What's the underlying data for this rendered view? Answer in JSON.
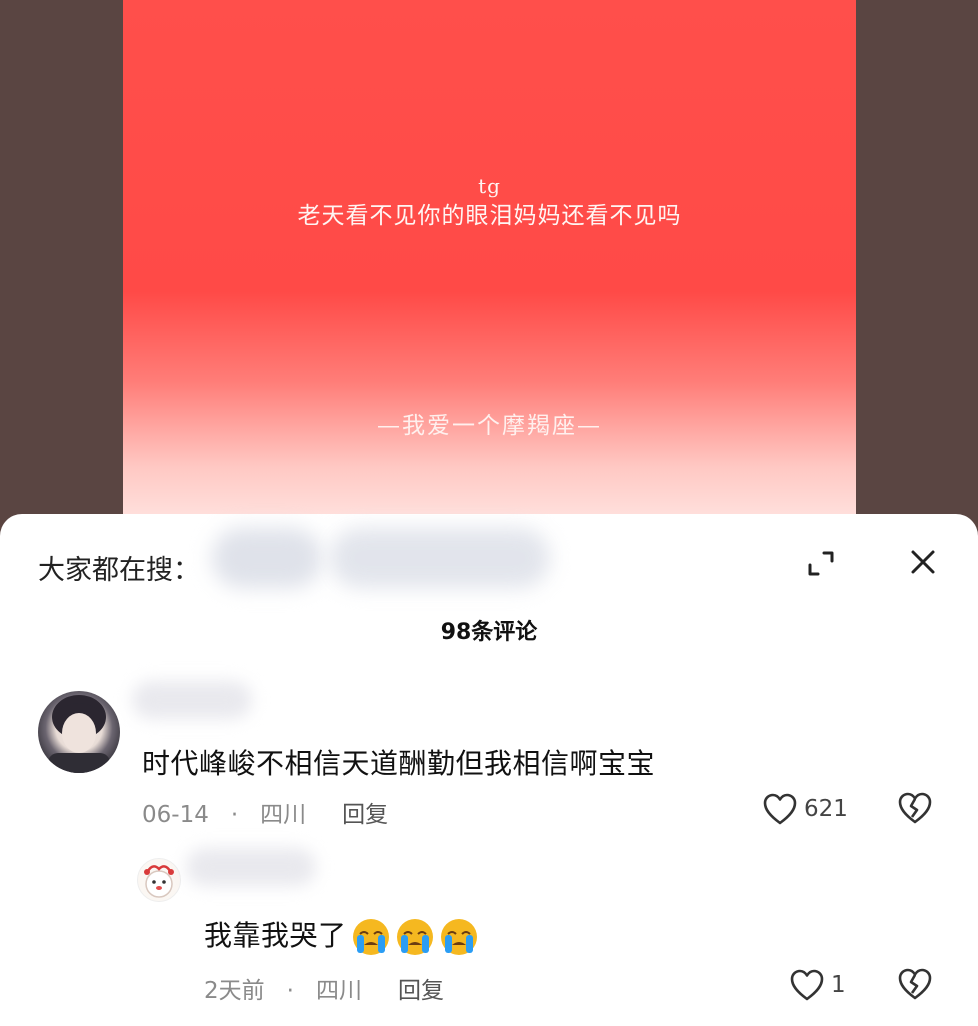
{
  "video": {
    "tag": "tg",
    "line1": "老天看不见你的眼泪妈妈还看不见吗",
    "line2": "—我爱一个摩羯座—"
  },
  "sheet": {
    "search_label": "大家都在搜：",
    "comment_count": "98条评论"
  },
  "comments": [
    {
      "text": "时代峰峻不相信天道酬勤但我相信啊宝宝",
      "date": "06-14",
      "location": "四川",
      "reply_label": "回复",
      "likes": "621"
    },
    {
      "text": "我靠我哭了",
      "emoji": "crying-emoji",
      "date": "2天前",
      "location": "四川",
      "reply_label": "回复",
      "likes": "1"
    }
  ],
  "icons": {
    "expand": "expand-icon",
    "close": "close-icon",
    "like": "heart-outline-icon",
    "dislike": "broken-heart-icon"
  },
  "colors": {
    "video_red": "#ff4f4b",
    "emoji_yellow": "#f5b820",
    "emoji_tear": "#2a9df4"
  }
}
